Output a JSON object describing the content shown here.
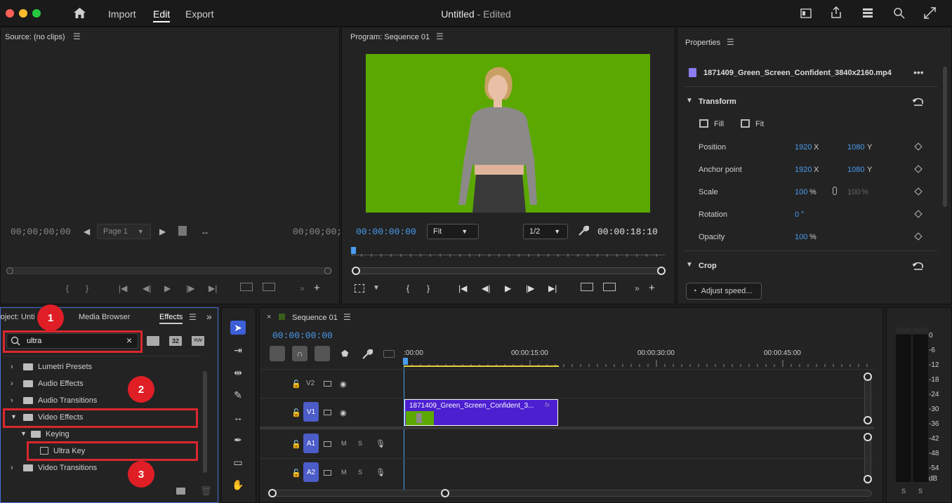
{
  "app": {
    "nav": {
      "import": "Import",
      "edit": "Edit",
      "export": "Export"
    },
    "title": "Untitled",
    "title_suffix": " - Edited"
  },
  "source": {
    "title": "Source: (no clips)",
    "tc_left": "00;00;00;00",
    "tc_right": "00;00;00;0",
    "page_select": "Page 1"
  },
  "program": {
    "title": "Program: Sequence 01",
    "tc_current": "00:00:00:00",
    "fit": "Fit",
    "resolution": "1/2",
    "tc_duration": "00:00:18:10"
  },
  "properties": {
    "title": "Properties",
    "clip_name": "1871409_Green_Screen_Confident_3840x2160.mp4",
    "transform": "Transform",
    "fill": "Fill",
    "fit": "Fit",
    "rows": [
      {
        "label": "Position",
        "v1": "1920",
        "u1": "X",
        "v2": "1080",
        "u2": "Y"
      },
      {
        "label": "Anchor point",
        "v1": "1920",
        "u1": "X",
        "v2": "1080",
        "u2": "Y"
      },
      {
        "label": "Scale",
        "v1": "100",
        "u1": "%",
        "v2": "100",
        "u2": "%"
      },
      {
        "label": "Rotation",
        "v1": "0",
        "u1": "°",
        "v2": "",
        "u2": ""
      },
      {
        "label": "Opacity",
        "v1": "100",
        "u1": "%",
        "v2": "",
        "u2": ""
      }
    ],
    "crop": "Crop",
    "adjust_speed": "Adjust speed..."
  },
  "effects": {
    "tabs": {
      "project": "roject: Unti",
      "media": "Media Browser",
      "effects": "Effects"
    },
    "search_value": "ultra",
    "btn_32": "32",
    "btn_yuv": "YUV",
    "tree": [
      {
        "label": "Lumetri Presets"
      },
      {
        "label": "Audio Effects"
      },
      {
        "label": "Audio Transitions"
      },
      {
        "label": "Video Effects"
      },
      {
        "label": "Keying"
      },
      {
        "label": "Ultra Key"
      },
      {
        "label": "Video Transitions"
      }
    ],
    "badges": {
      "b1": "1",
      "b2": "2",
      "b3": "3"
    }
  },
  "timeline": {
    "title": "Sequence 01",
    "tc": "00:00:00:00",
    "ruler": [
      ":00:00",
      "00:00:15:00",
      "00:00:30:00",
      "00:00:45:00"
    ],
    "tracks": {
      "v2": "V2",
      "v1": "V1",
      "a1": "A1",
      "a2": "A2",
      "m": "M",
      "s": "S"
    },
    "clip_name": "1871409_Green_Screen_Confident_3..."
  },
  "meter": {
    "labels": [
      "0",
      "-6",
      "-12",
      "-18",
      "-24",
      "-30",
      "-36",
      "-42",
      "-48",
      "-54",
      "dB"
    ],
    "s_left": "S",
    "s_right": "S"
  },
  "colors": {
    "accent": "#4a9df0",
    "green_screen": "#5ba800",
    "clip": "#4c1fd1",
    "highlight": "#d9272e"
  }
}
